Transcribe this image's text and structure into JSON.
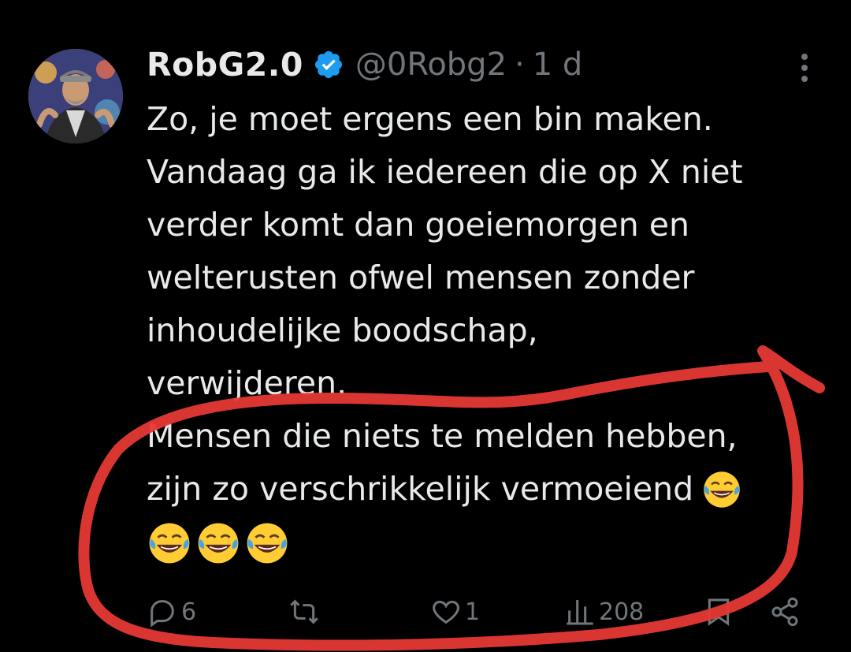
{
  "tweet": {
    "display_name": "RobG2.0",
    "handle": "@0Robg2",
    "separator": "·",
    "time": "1 d",
    "lines": [
      "Zo, je moet ergens een bin maken.",
      "Vandaag ga ik iedereen die op X niet",
      "verder komt dan goeiemorgen en",
      "welterusten ofwel mensen zonder",
      "inhoudelijke boodschap,",
      "verwijderen.",
      "Mensen die niets te melden hebben,",
      "zijn zo verschrikkelijk vermoeiend"
    ],
    "emoji_name": "face-with-tears-of-joy",
    "emoji_count_trailing": 3
  },
  "actions": {
    "replies": "6",
    "reposts": "",
    "likes": "1",
    "views": "208"
  },
  "icons": {
    "verified": "verified-badge-icon",
    "more": "more-vertical-icon",
    "reply": "reply-icon",
    "repost": "repost-icon",
    "like": "heart-icon",
    "views": "views-icon",
    "bookmark": "bookmark-icon",
    "share": "share-icon"
  },
  "colors": {
    "background": "#000000",
    "text": "#e7e9ea",
    "secondary": "#71767b",
    "verified": "#1d9bf0",
    "annotation": "#e53935"
  }
}
